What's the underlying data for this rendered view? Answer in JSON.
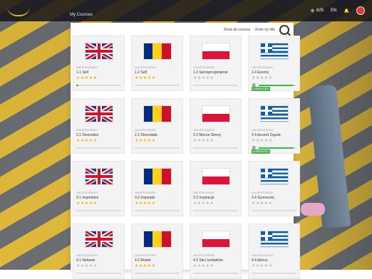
{
  "topbar": {
    "points": "625",
    "lang": "EN"
  },
  "breadcrumb": "My Courses",
  "panel": {
    "show_label": "Show all courses",
    "order_label": "Order by title"
  },
  "cards": [
    {
      "title": "1.1 Self",
      "flag": "uk",
      "rated": true,
      "progress": 0.05,
      "badge": "",
      "icon": false,
      "meta": "UNCATEGORIZED"
    },
    {
      "title": "1.2 Self",
      "flag": "ro",
      "rated": true,
      "progress": 0,
      "badge": "",
      "icon": false,
      "meta": "UNCATEGORIZED"
    },
    {
      "title": "1.3 Samoprocjenjenie",
      "flag": "pl",
      "rated": false,
      "progress": 0,
      "badge": "",
      "icon": false,
      "meta": "UNCATEGORIZED"
    },
    {
      "title": "1.4 Εαυτός",
      "flag": "gr",
      "rated": false,
      "progress": 0.92,
      "badge": "COMPLETED",
      "icon": true,
      "meta": "UNCATEGORIZED"
    },
    {
      "title": "2.1 Diversities",
      "flag": "uk",
      "rated": true,
      "progress": 0,
      "badge": "",
      "icon": false,
      "meta": "UNCATEGORIZED"
    },
    {
      "title": "2.2 Diversitate",
      "flag": "ro",
      "rated": true,
      "progress": 0,
      "badge": "",
      "icon": false,
      "meta": "UNCATEGORIZED"
    },
    {
      "title": "2.3 Mocne Strony",
      "flag": "pl",
      "rated": false,
      "progress": 0,
      "badge": "",
      "icon": false,
      "meta": "UNCATEGORIZED"
    },
    {
      "title": "2.4 Δυνατά Σημεία",
      "flag": "gr",
      "rated": false,
      "progress": 0.92,
      "badge": "COMPLETED",
      "icon": true,
      "meta": "UNCATEGORIZED"
    },
    {
      "title": "3.1 Inspiration",
      "flag": "uk",
      "rated": true,
      "progress": 0,
      "badge": "",
      "icon": false,
      "meta": "UNCATEGORIZED"
    },
    {
      "title": "3.2 Inspirație",
      "flag": "ro",
      "rated": true,
      "progress": 0,
      "badge": "",
      "icon": false,
      "meta": "UNCATEGORIZED"
    },
    {
      "title": "3.3 Inspiracje",
      "flag": "pl",
      "rated": false,
      "progress": 0,
      "badge": "",
      "icon": false,
      "meta": "UNCATEGORIZED"
    },
    {
      "title": "3.4 Έμπνευση",
      "flag": "gr",
      "rated": false,
      "progress": 0,
      "badge": "",
      "icon": false,
      "meta": "UNCATEGORIZED"
    },
    {
      "title": "4.1 Network",
      "flag": "uk",
      "rated": false,
      "progress": 0,
      "badge": "",
      "icon": false,
      "meta": "UNCATEGORIZED"
    },
    {
      "title": "4.2 Rețele",
      "flag": "ro",
      "rated": true,
      "progress": 0,
      "badge": "",
      "icon": false,
      "meta": "UNCATEGORIZED"
    },
    {
      "title": "4.3 Sieć kontaktów",
      "flag": "pl",
      "rated": false,
      "progress": 0,
      "badge": "",
      "icon": false,
      "meta": "UNCATEGORIZED"
    },
    {
      "title": "4.4 Δίκτυο",
      "flag": "gr",
      "rated": false,
      "progress": 0,
      "badge": "",
      "icon": false,
      "meta": "UNCATEGORIZED"
    }
  ]
}
